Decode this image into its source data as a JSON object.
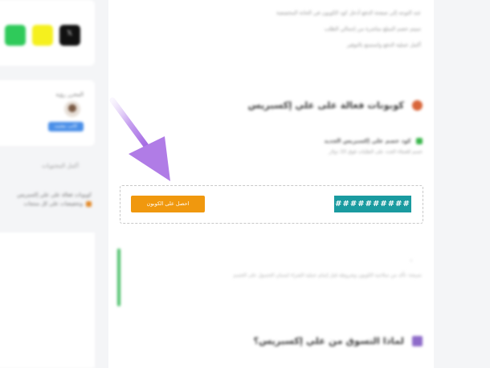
{
  "sidebar": {
    "social_x_icon": "x-logo-icon",
    "author_name": "المحرر رؤية",
    "author_badge": "كاتب معتمد",
    "toc_title": "أكمل المحتويات",
    "toc_item": "كوبونات فعالة على علي إكسبريس وتخفيضات على كل منتجات"
  },
  "main": {
    "intro_lines": [
      "عند التوجه إلى صفحة الدفع أدخل كود الكوبون في الخانة المخصصة",
      "سيتم خصم المبلغ مباشرة من إجمالي الطلب",
      "أكمل عملية الدفع واستمتع بالتوفير"
    ],
    "heading_coupons": "كوبونات فعالة على علي إكسبريس",
    "coupon_name": "كود خصم علي إكسبريس الجديد",
    "coupon_desc": "خصم للعملاء الجدد على الطلبات فوق 10 دولار",
    "coupon_code": "##########",
    "get_coupon_label": "احصل على الكوبون",
    "note_text": "نصيحة: تأكد من صلاحية الكوبون وشروطه قبل إتمام عملية الشراء لضمان الحصول على الخصم",
    "heading_why": "لماذا التسوق من علي إكسبريس؟"
  },
  "colors": {
    "accent_orange": "#f0980e",
    "code_teal": "#1a9ba0",
    "note_green": "#4cc06a",
    "arrow_purple": "#b07ce6"
  }
}
